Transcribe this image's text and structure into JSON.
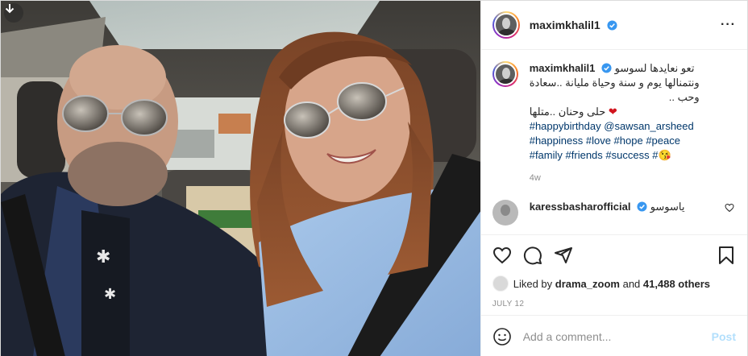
{
  "post": {
    "author": "maximkhalil1",
    "more_icon": "more-horizontal-icon",
    "download_icon": "download-arrow-icon"
  },
  "caption": {
    "user": "maximkhalil1",
    "line1": "تعو نعايدها لسوسو",
    "line2": "ونتمنالها يوم و سنة وحياة مليانة ..سعادة",
    "line3": "وحب ..",
    "line4": "حلى وحنان ..متلها",
    "heart_emoji": "❤",
    "hashtags_line1": "#happybirthday",
    "mention": "@sawsan_arsheed",
    "hashtags_line2": [
      "#happiness",
      "#love",
      "#hope",
      "#peace"
    ],
    "hashtags_line3": [
      "#family",
      "#friends",
      "#success",
      "#"
    ],
    "kiss_emoji": "😘",
    "time": "4w"
  },
  "second_comment": {
    "user": "karessbasharofficial",
    "text": "ياسوسو"
  },
  "actions": {
    "icons": [
      "heart-outline-icon",
      "comment-icon",
      "share-plane-icon",
      "bookmark-icon"
    ]
  },
  "likes": {
    "prefix": "Liked by",
    "user": "drama_zoom",
    "and": "and",
    "count": "41,488 others"
  },
  "date": "JULY 12",
  "add_comment": {
    "placeholder": "Add a comment...",
    "post_label": "Post"
  },
  "colors": {
    "link": "#00376b",
    "verified": "#3897f0",
    "post_disabled": "#b2dffc",
    "muted": "#8e8e8e"
  }
}
